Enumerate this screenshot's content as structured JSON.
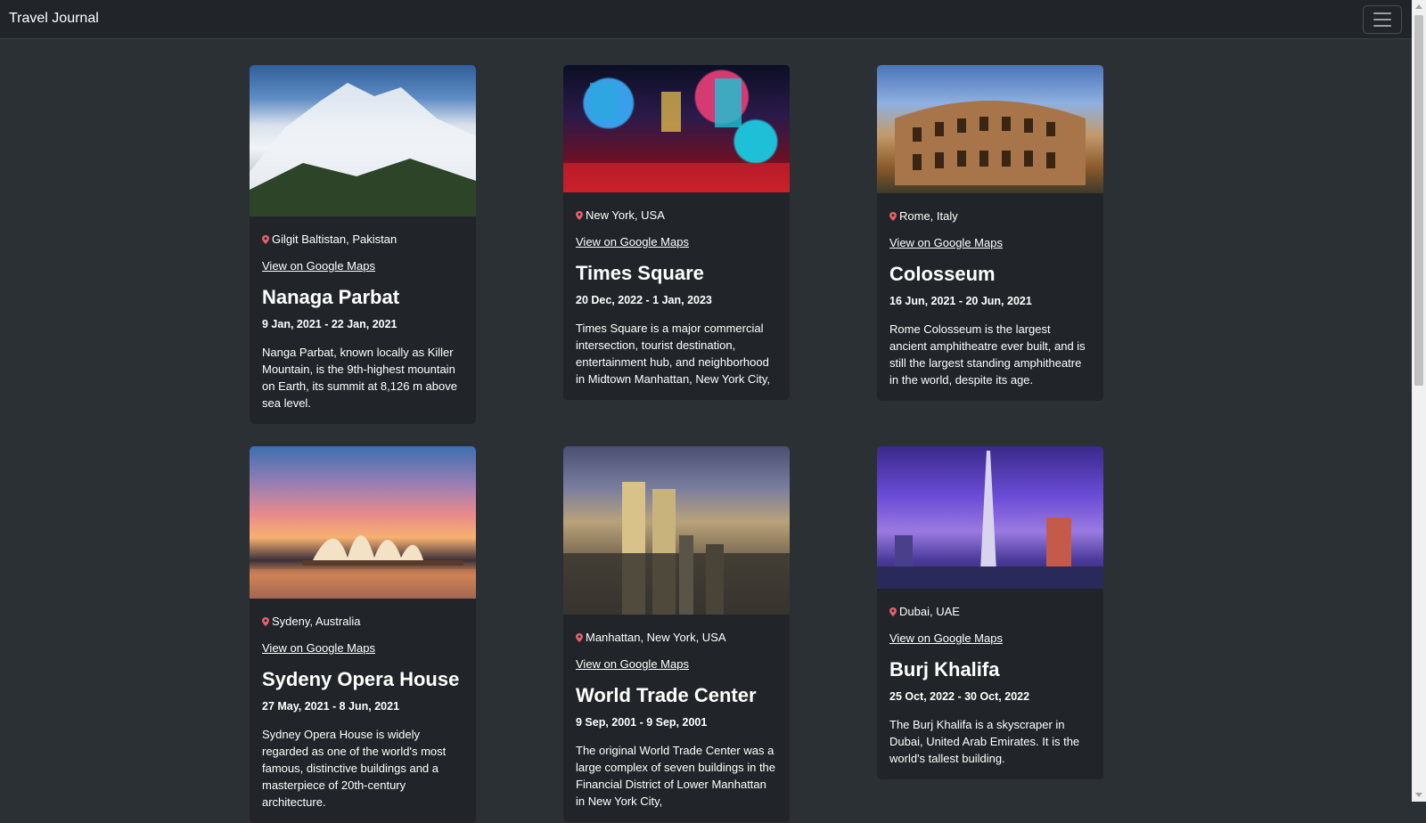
{
  "navbar": {
    "brand": "Travel Journal"
  },
  "cards": [
    {
      "location": "Gilgit Baltistan, Pakistan",
      "maps_link": "View on Google Maps",
      "title": "Nanaga Parbat",
      "dates": "9 Jan, 2021 - 22 Jan, 2021",
      "description": "Nanga Parbat, known locally as Killer Mountain, is the 9th-highest mountain on Earth, its summit at 8,126 m above sea level."
    },
    {
      "location": "New York, USA",
      "maps_link": "View on Google Maps",
      "title": "Times Square",
      "dates": "20 Dec, 2022 - 1 Jan, 2023",
      "description": "Times Square is a major commercial intersection, tourist destination, entertainment hub, and neighborhood in Midtown Manhattan, New York City,"
    },
    {
      "location": "Rome, Italy",
      "maps_link": "View on Google Maps",
      "title": "Colosseum",
      "dates": "16 Jun, 2021 - 20 Jun, 2021",
      "description": "Rome Colosseum is the largest ancient amphitheatre ever built, and is still the largest standing amphitheatre in the world, despite its age."
    },
    {
      "location": "Sydeny, Australia",
      "maps_link": "View on Google Maps",
      "title": "Sydeny Opera House",
      "dates": "27 May, 2021 - 8 Jun, 2021",
      "description": "Sydney Opera House is widely regarded as one of the world's most famous, distinctive buildings and a masterpiece of 20th-century architecture."
    },
    {
      "location": "Manhattan, New York, USA",
      "maps_link": "View on Google Maps",
      "title": "World Trade Center",
      "dates": "9 Sep, 2001 - 9 Sep, 2001",
      "description": "The original World Trade Center was a large complex of seven buildings in the Financial District of Lower Manhattan in New York City,"
    },
    {
      "location": "Dubai, UAE",
      "maps_link": "View on Google Maps",
      "title": "Burj Khalifa",
      "dates": "25 Oct, 2022 - 30 Oct, 2022",
      "description": "The Burj Khalifa is a skyscraper in Dubai, United Arab Emirates. It is the world's tallest building."
    }
  ],
  "icons": {
    "location": "map-pin-icon",
    "menu": "hamburger-menu-icon"
  },
  "colors": {
    "page_bg": "#2b3035",
    "navbar_bg": "#212529",
    "card_bg": "#212529",
    "pin": "#e8606a"
  }
}
